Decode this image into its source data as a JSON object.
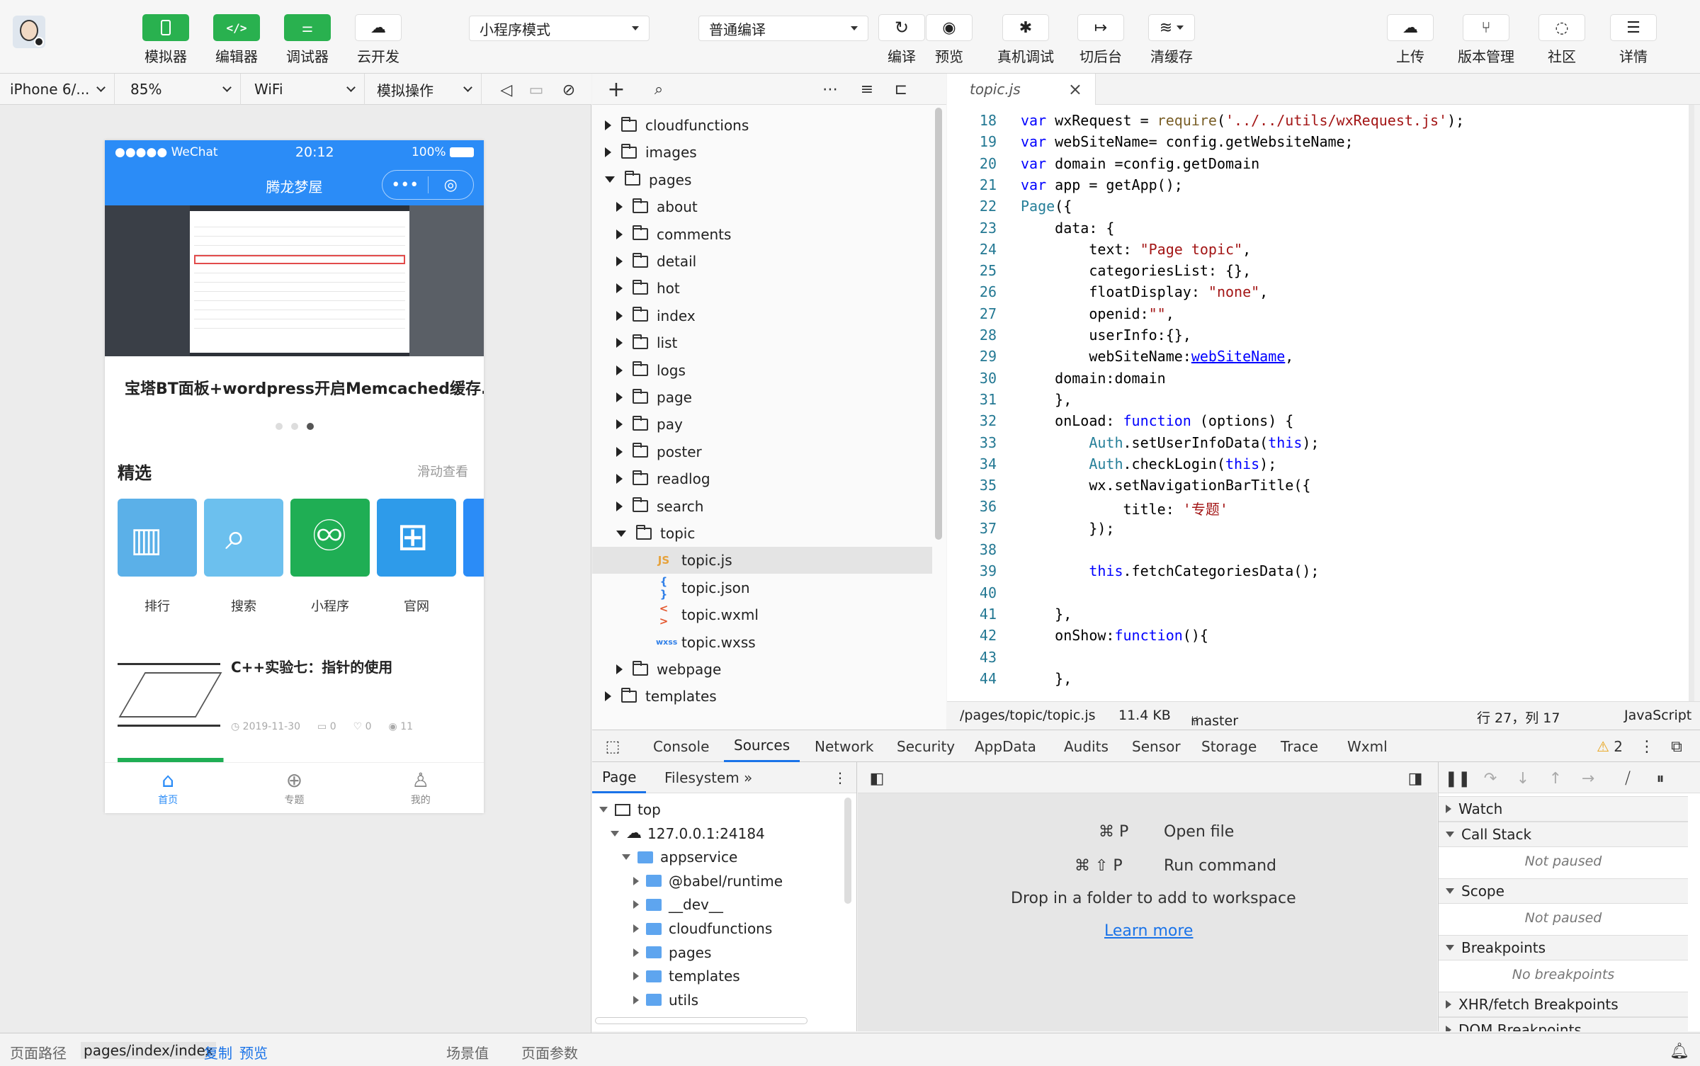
{
  "toolbar": {
    "left_buttons": [
      {
        "label": "模拟器",
        "icon": "phone-icon"
      },
      {
        "label": "编辑器",
        "icon": "code-icon"
      },
      {
        "label": "调试器",
        "icon": "debug-sliders-icon"
      },
      {
        "label": "云开发",
        "icon": "cloud-link-icon"
      }
    ],
    "mode_select": "小程序模式",
    "compile_select": "普通编译",
    "mid_buttons": [
      {
        "label": "编译",
        "icon": "refresh-icon"
      },
      {
        "label": "预览",
        "icon": "eye-icon"
      },
      {
        "label": "真机调试",
        "icon": "bug-icon"
      },
      {
        "label": "切后台",
        "icon": "switch-icon"
      },
      {
        "label": "清缓存",
        "icon": "layers-icon"
      }
    ],
    "right_buttons": [
      {
        "label": "上传",
        "icon": "upload-cloud-icon"
      },
      {
        "label": "版本管理",
        "icon": "branch-icon"
      },
      {
        "label": "社区",
        "icon": "chat-icon"
      },
      {
        "label": "详情",
        "icon": "menu-icon"
      }
    ]
  },
  "simulator_bar": {
    "device": "iPhone 6/...",
    "zoom": "85%",
    "network": "WiFi",
    "operation": "模拟操作"
  },
  "phone": {
    "carrier": "●●●●● WeChat",
    "time": "20:12",
    "battery": "100%",
    "nav_title": "腾龙梦屋",
    "capsule_more": "•••",
    "capsule_close": "◎",
    "banner_title": "宝塔BT面板+wordpress开启Memcached缓存...",
    "featured_heading": "精选",
    "featured_more": "滑动查看",
    "tiles": [
      {
        "label": "排行",
        "color": "#5bb0e8"
      },
      {
        "label": "搜索",
        "color": "#6cc0ee"
      },
      {
        "label": "小程序",
        "color": "#1fae54"
      },
      {
        "label": "官网",
        "color": "#2e9bea"
      }
    ],
    "post_title": "C++实验七：指针的使用",
    "post_date": "◷ 2019-11-30",
    "post_comments": "▭ 0",
    "post_likes": "♡ 0",
    "post_views": "◉ 11",
    "tabbar": [
      {
        "label": "首页",
        "icon": "⌂"
      },
      {
        "label": "专题",
        "icon": "⊕"
      },
      {
        "label": "我的",
        "icon": "♙"
      }
    ]
  },
  "tree": {
    "items": [
      {
        "name": "cloudfunctions",
        "depth": 0,
        "kind": "folder",
        "open": false
      },
      {
        "name": "images",
        "depth": 0,
        "kind": "folder",
        "open": false
      },
      {
        "name": "pages",
        "depth": 0,
        "kind": "folder",
        "open": true
      },
      {
        "name": "about",
        "depth": 1,
        "kind": "folder",
        "open": false
      },
      {
        "name": "comments",
        "depth": 1,
        "kind": "folder",
        "open": false
      },
      {
        "name": "detail",
        "depth": 1,
        "kind": "folder",
        "open": false
      },
      {
        "name": "hot",
        "depth": 1,
        "kind": "folder",
        "open": false
      },
      {
        "name": "index",
        "depth": 1,
        "kind": "folder",
        "open": false
      },
      {
        "name": "list",
        "depth": 1,
        "kind": "folder",
        "open": false
      },
      {
        "name": "logs",
        "depth": 1,
        "kind": "folder",
        "open": false
      },
      {
        "name": "page",
        "depth": 1,
        "kind": "folder",
        "open": false
      },
      {
        "name": "pay",
        "depth": 1,
        "kind": "folder",
        "open": false
      },
      {
        "name": "poster",
        "depth": 1,
        "kind": "folder",
        "open": false
      },
      {
        "name": "readlog",
        "depth": 1,
        "kind": "folder",
        "open": false
      },
      {
        "name": "search",
        "depth": 1,
        "kind": "folder",
        "open": false
      },
      {
        "name": "topic",
        "depth": 1,
        "kind": "folder",
        "open": true
      },
      {
        "name": "topic.js",
        "depth": 2,
        "kind": "js",
        "glyph": "JS",
        "color": "#e6a23c"
      },
      {
        "name": "topic.json",
        "depth": 2,
        "kind": "json",
        "glyph": "{ }",
        "color": "#2f7fe8"
      },
      {
        "name": "topic.wxml",
        "depth": 2,
        "kind": "wxml",
        "glyph": "< >",
        "color": "#e4572e"
      },
      {
        "name": "topic.wxss",
        "depth": 2,
        "kind": "wxss",
        "glyph": "wxss",
        "color": "#2f7fe8"
      },
      {
        "name": "webpage",
        "depth": 1,
        "kind": "folder",
        "open": false
      },
      {
        "name": "templates",
        "depth": 0,
        "kind": "folder",
        "open": false
      }
    ]
  },
  "editor": {
    "tab_name": "topic.js",
    "lines": [
      {
        "n": "18",
        "html": "<span class=\"kw\">var</span> wxRequest = <span class=\"fn\">require</span>(<span class=\"str\">'../../utils/wxRequest.js'</span>);"
      },
      {
        "n": "19",
        "html": "<span class=\"kw\">var</span> webSiteName= config.getWebsiteName;"
      },
      {
        "n": "20",
        "html": "<span class=\"kw\">var</span> domain =config.getDomain"
      },
      {
        "n": "21",
        "html": "<span class=\"kw\">var</span> app = getApp();"
      },
      {
        "n": "22",
        "html": "<span class=\"ty\">Page</span>({"
      },
      {
        "n": "23",
        "html": "    data: {"
      },
      {
        "n": "24",
        "html": "        text: <span class=\"str\">\"Page topic\"</span>,"
      },
      {
        "n": "25",
        "html": "        categoriesList: {},"
      },
      {
        "n": "26",
        "html": "        floatDisplay: <span class=\"str\">\"none\"</span>,"
      },
      {
        "n": "27",
        "html": "        openid:<span class=\"str\">\"\"</span>,"
      },
      {
        "n": "28",
        "html": "        userInfo:{},"
      },
      {
        "n": "29",
        "html": "        webSiteName:<span class=\"link\">webSiteName</span>,"
      },
      {
        "n": "30",
        "html": "    domain:domain"
      },
      {
        "n": "31",
        "html": "    },"
      },
      {
        "n": "32",
        "html": "    onLoad: <span class=\"kw\">function</span> (options) {"
      },
      {
        "n": "33",
        "html": "        <span class=\"ty\">Auth</span>.setUserInfoData(<span class=\"kw\">this</span>);"
      },
      {
        "n": "34",
        "html": "        <span class=\"ty\">Auth</span>.checkLogin(<span class=\"kw\">this</span>);"
      },
      {
        "n": "35",
        "html": "        wx.setNavigationBarTitle({"
      },
      {
        "n": "36",
        "html": "            title: <span class=\"str\">'专题'</span>"
      },
      {
        "n": "37",
        "html": "        });"
      },
      {
        "n": "38",
        "html": ""
      },
      {
        "n": "39",
        "html": "        <span class=\"kw\">this</span>.fetchCategoriesData();"
      },
      {
        "n": "40",
        "html": ""
      },
      {
        "n": "41",
        "html": "    },"
      },
      {
        "n": "42",
        "html": "    onShow:<span class=\"kw\">function</span>(){"
      },
      {
        "n": "43",
        "html": ""
      },
      {
        "n": "44",
        "html": "    },"
      }
    ],
    "status": {
      "path": "/pages/topic/topic.js",
      "size": "11.4 KB",
      "branch": "master",
      "position": "行 27，列 17",
      "language": "JavaScript"
    }
  },
  "devtools": {
    "tabs": [
      "Console",
      "Sources",
      "Network",
      "Security",
      "AppData",
      "Audits",
      "Sensor",
      "Storage",
      "Trace",
      "Wxml"
    ],
    "active_tab": "Sources",
    "warning_count": "2",
    "left_subtabs": [
      "Page",
      "Filesystem"
    ],
    "nav_tree": [
      {
        "name": "top",
        "depth": 0,
        "icon": "frame",
        "open": true
      },
      {
        "name": "127.0.0.1:24184",
        "depth": 1,
        "icon": "cloud",
        "open": true
      },
      {
        "name": "appservice",
        "depth": 2,
        "icon": "folder",
        "open": true
      },
      {
        "name": "@babel/runtime",
        "depth": 3,
        "icon": "folder",
        "open": false
      },
      {
        "name": "__dev__",
        "depth": 3,
        "icon": "folder",
        "open": false
      },
      {
        "name": "cloudfunctions",
        "depth": 3,
        "icon": "folder",
        "open": false
      },
      {
        "name": "pages",
        "depth": 3,
        "icon": "folder",
        "open": false
      },
      {
        "name": "templates",
        "depth": 3,
        "icon": "folder",
        "open": false
      },
      {
        "name": "utils",
        "depth": 3,
        "icon": "folder",
        "open": false
      }
    ],
    "shortcuts": [
      {
        "keys": "⌘ P",
        "label": "Open file"
      },
      {
        "keys": "⌘ ⇧ P",
        "label": "Run command"
      }
    ],
    "drop_text": "Drop in a folder to add to workspace",
    "learn_more": "Learn more",
    "panes": [
      {
        "title": "Watch",
        "open": false,
        "body": ""
      },
      {
        "title": "Call Stack",
        "open": true,
        "body": "Not paused"
      },
      {
        "title": "Scope",
        "open": true,
        "body": "Not paused"
      },
      {
        "title": "Breakpoints",
        "open": true,
        "body": "No breakpoints"
      },
      {
        "title": "XHR/fetch Breakpoints",
        "open": false,
        "body": ""
      },
      {
        "title": "DOM Breakpoints",
        "open": false,
        "body": ""
      }
    ]
  },
  "bottom": {
    "path_label": "页面路径",
    "path_value": "pages/index/index",
    "copy": "复制",
    "preview": "预览",
    "scene": "场景值",
    "params": "页面参数"
  }
}
